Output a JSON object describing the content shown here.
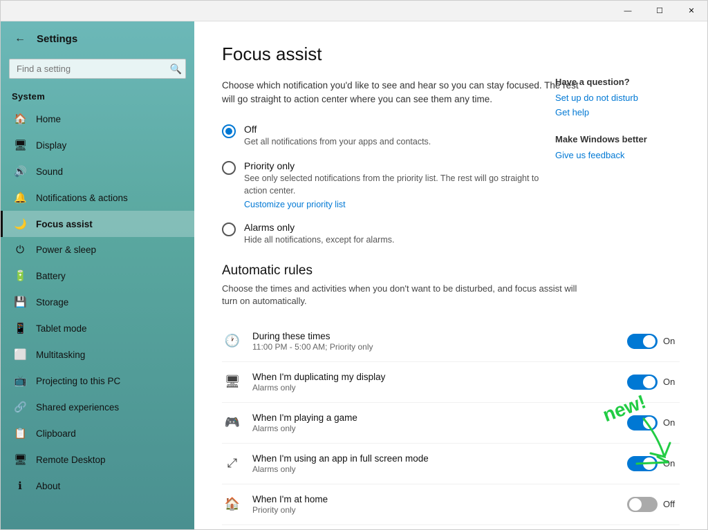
{
  "titlebar": {
    "minimize": "—",
    "maximize": "☐",
    "close": "✕"
  },
  "sidebar": {
    "app_title": "Settings",
    "search_placeholder": "Find a setting",
    "section_label": "System",
    "items": [
      {
        "id": "home",
        "label": "Home",
        "icon": "🏠"
      },
      {
        "id": "display",
        "label": "Display",
        "icon": "🖥"
      },
      {
        "id": "sound",
        "label": "Sound",
        "icon": "🔊"
      },
      {
        "id": "notifications",
        "label": "Notifications & actions",
        "icon": "🔔"
      },
      {
        "id": "focus-assist",
        "label": "Focus assist",
        "icon": "🌙",
        "active": true
      },
      {
        "id": "power-sleep",
        "label": "Power & sleep",
        "icon": "⏻"
      },
      {
        "id": "battery",
        "label": "Battery",
        "icon": "🔋"
      },
      {
        "id": "storage",
        "label": "Storage",
        "icon": "💾"
      },
      {
        "id": "tablet-mode",
        "label": "Tablet mode",
        "icon": "📱"
      },
      {
        "id": "multitasking",
        "label": "Multitasking",
        "icon": "⬜"
      },
      {
        "id": "projecting",
        "label": "Projecting to this PC",
        "icon": "📺"
      },
      {
        "id": "shared-experiences",
        "label": "Shared experiences",
        "icon": "🔗"
      },
      {
        "id": "clipboard",
        "label": "Clipboard",
        "icon": "📋"
      },
      {
        "id": "remote-desktop",
        "label": "Remote Desktop",
        "icon": "🖥"
      },
      {
        "id": "about",
        "label": "About",
        "icon": "ℹ"
      }
    ]
  },
  "main": {
    "page_title": "Focus assist",
    "description": "Choose which notification you'd like to see and hear so you can stay focused. The rest will go straight to action center where you can see them any time.",
    "radio_options": [
      {
        "id": "off",
        "label": "Off",
        "sublabel": "Get all notifications from your apps and contacts.",
        "selected": true
      },
      {
        "id": "priority-only",
        "label": "Priority only",
        "sublabel": "See only selected notifications from the priority list. The rest will go straight to action center.",
        "link": "Customize your priority list",
        "selected": false
      },
      {
        "id": "alarms-only",
        "label": "Alarms only",
        "sublabel": "Hide all notifications, except for alarms.",
        "selected": false
      }
    ],
    "automatic_rules": {
      "heading": "Automatic rules",
      "description": "Choose the times and activities when you don't want to be disturbed, and focus assist will turn on automatically.",
      "rules": [
        {
          "id": "during-times",
          "icon": "🕐",
          "title": "During these times",
          "subtitle": "11:00 PM - 5:00 AM; Priority only",
          "toggle": "on",
          "toggle_label": "On"
        },
        {
          "id": "duplicating-display",
          "icon": "🖥",
          "title": "When I'm duplicating my display",
          "subtitle": "Alarms only",
          "toggle": "on",
          "toggle_label": "On"
        },
        {
          "id": "playing-game",
          "icon": "🎮",
          "title": "When I'm playing a game",
          "subtitle": "Alarms only",
          "toggle": "on",
          "toggle_label": "On"
        },
        {
          "id": "full-screen",
          "icon": "⤢",
          "title": "When I'm using an app in full screen mode",
          "subtitle": "Alarms only",
          "toggle": "on",
          "toggle_label": "On"
        },
        {
          "id": "at-home",
          "icon": "🏠",
          "title": "When I'm at home",
          "subtitle": "Priority only",
          "toggle": "off",
          "toggle_label": "Off"
        }
      ]
    }
  },
  "right_panel": {
    "question_heading": "Have a question?",
    "links_1": [
      {
        "label": "Set up do not disturb"
      },
      {
        "label": "Get help"
      }
    ],
    "windows_heading": "Make Windows better",
    "links_2": [
      {
        "label": "Give us feedback"
      }
    ]
  }
}
